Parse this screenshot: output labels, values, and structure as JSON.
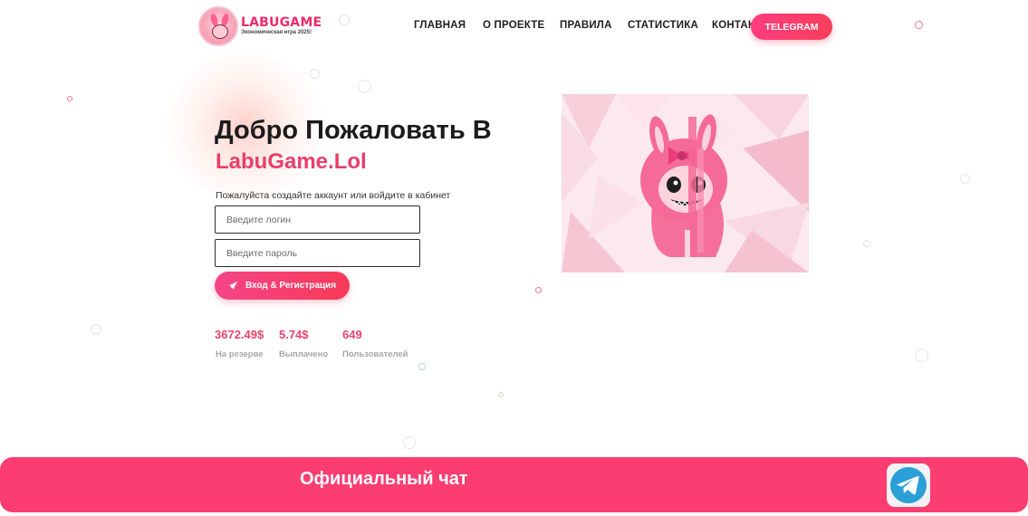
{
  "brand": {
    "name": "LABUGAME",
    "tagline": "Экономическая игра 2025!"
  },
  "nav": {
    "items": [
      "ГЛАВНАЯ",
      "О ПРОЕКТЕ",
      "ПРАВИЛА",
      "СТАТИСТИКА",
      "КОНТАКТ"
    ],
    "telegram_label": "TELEGRAM"
  },
  "hero": {
    "title": "Добро Пожаловать В",
    "brand": "LabuGame.Lol",
    "subtitle": "Пожалуйста создайте аккаунт или войдите в кабинет",
    "login_placeholder": "Введите логин",
    "password_placeholder": "Введите пароль",
    "submit_label": "Вход & Регистрация"
  },
  "stats": [
    {
      "value": "3672.49$",
      "label": "На резерве"
    },
    {
      "value": "5.74$",
      "label": "Выплачено"
    },
    {
      "value": "649",
      "label": "Пользователей"
    }
  ],
  "footer": {
    "chat_title": "Официальный чат",
    "icon": "telegram-icon"
  },
  "colors": {
    "accent": "#fb3d72",
    "brand_text": "#ec3d6a",
    "stat_value": "#e8436a"
  }
}
